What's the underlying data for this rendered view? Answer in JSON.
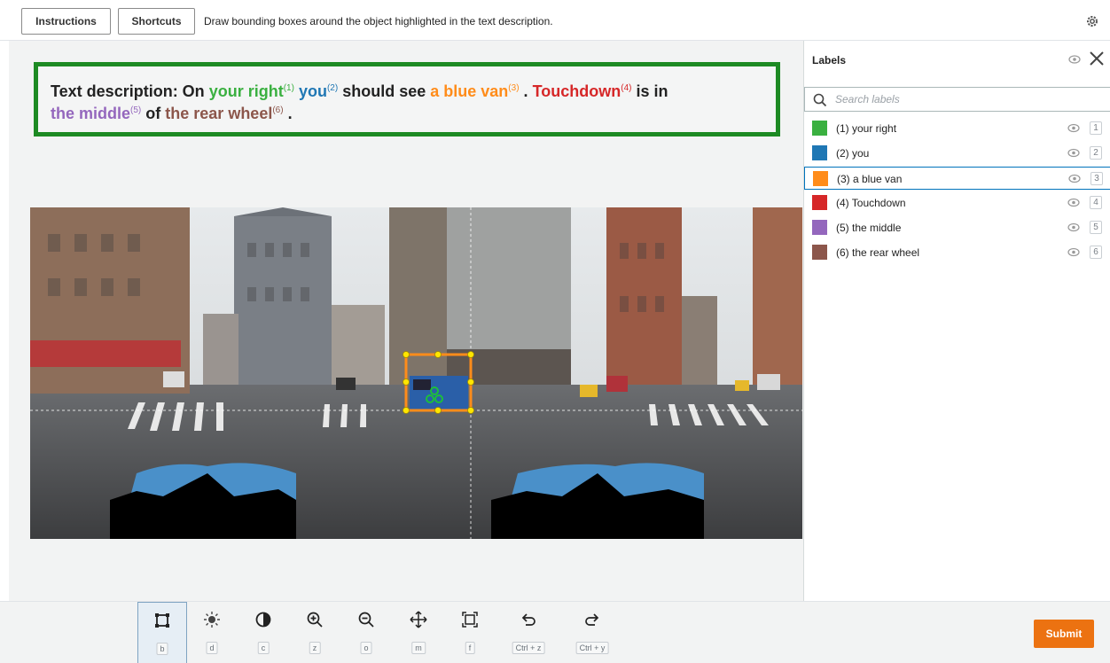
{
  "topbar": {
    "instructions_label": "Instructions",
    "shortcuts_label": "Shortcuts",
    "instruction_text": "Draw bounding boxes around the object highlighted in the text description."
  },
  "description": {
    "prefix": "Text description: On",
    "t1": "your right",
    "s1": "(1)",
    "t2": "you",
    "s2": "(2)",
    "mid1": "should see",
    "t3": "a blue van",
    "s3": "(3)",
    "dot1": ".",
    "t4": "Touchdown",
    "s4": "(4)",
    "mid2": "is in",
    "t5": "the middle",
    "s5": "(5)",
    "mid3": "of",
    "t6": "the rear wheel",
    "s6": "(6)",
    "dot2": "."
  },
  "panel": {
    "title": "Labels",
    "search_placeholder": "Search labels",
    "labels": [
      {
        "text": "(1) your right",
        "key": "1",
        "color": "#3ab040"
      },
      {
        "text": "(2) you",
        "key": "2",
        "color": "#1f77b4"
      },
      {
        "text": "(3) a blue van",
        "key": "3",
        "color": "#ff8c1a"
      },
      {
        "text": "(4) Touchdown",
        "key": "4",
        "color": "#d62728"
      },
      {
        "text": "(5) the middle",
        "key": "5",
        "color": "#9467bd"
      },
      {
        "text": "(6) the rear wheel",
        "key": "6",
        "color": "#8c564b"
      }
    ],
    "selected_label": 2
  },
  "toolbar": {
    "tools": [
      {
        "name": "box-tool",
        "key": "b"
      },
      {
        "name": "brightness-tool",
        "key": "d"
      },
      {
        "name": "contrast-tool",
        "key": "c"
      },
      {
        "name": "zoom-in-tool",
        "key": "z"
      },
      {
        "name": "zoom-out-tool",
        "key": "o"
      },
      {
        "name": "move-tool",
        "key": "m"
      },
      {
        "name": "fit-tool",
        "key": "f"
      },
      {
        "name": "undo-tool",
        "key": "Ctrl + z"
      },
      {
        "name": "redo-tool",
        "key": "Ctrl + y"
      }
    ],
    "submit_label": "Submit"
  },
  "colors": {
    "accent": "#ec7211",
    "frame_green": "#1d8a23",
    "bbox_orange": "#ff8c1a",
    "selection_blue": "#0073bb"
  }
}
